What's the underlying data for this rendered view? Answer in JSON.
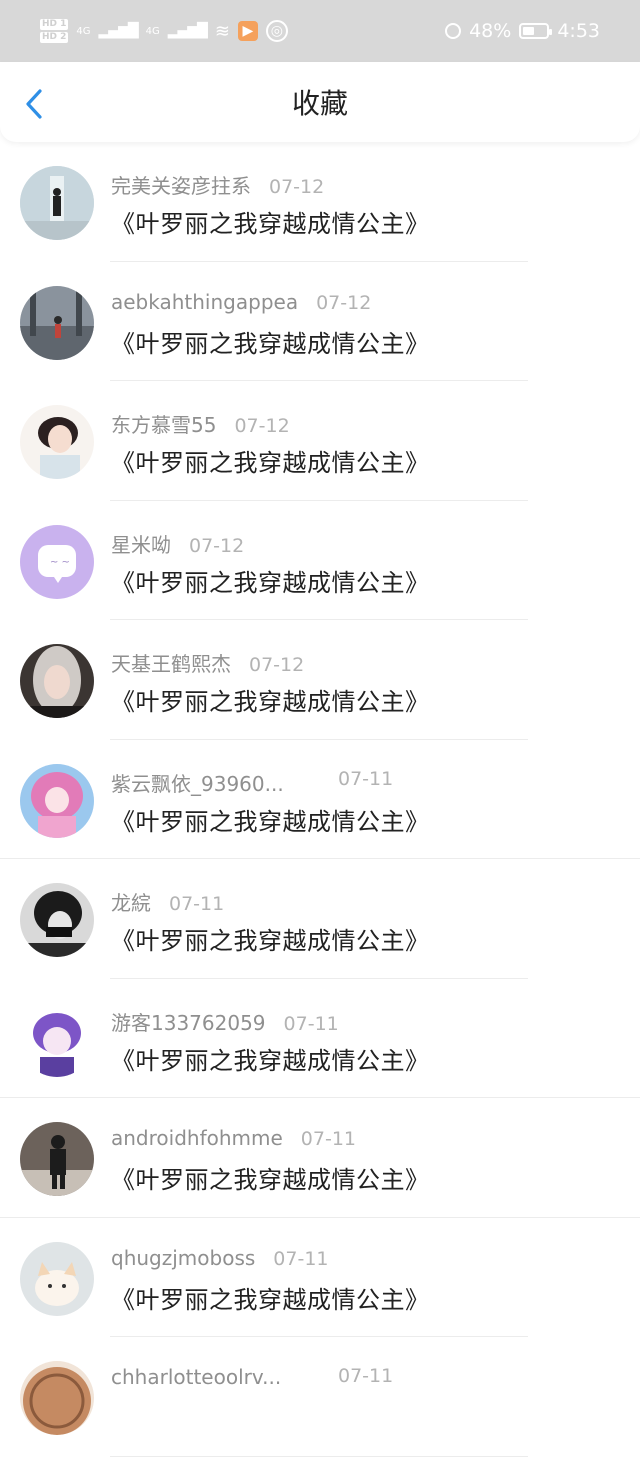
{
  "status_bar": {
    "hd1": "HD 1",
    "hd2": "HD 2",
    "net1": "4G",
    "net2": "4G",
    "battery": "48%",
    "time": "4:53",
    "battery_level": 0.48
  },
  "header": {
    "title": "收藏"
  },
  "items": [
    {
      "name": "完美关姿彦拄系",
      "date": "07-12",
      "book": "《叶罗丽之我穿越成情公主》"
    },
    {
      "name": "aebkahthingappea",
      "date": "07-12",
      "book": "《叶罗丽之我穿越成情公主》"
    },
    {
      "name": "东方慕雪55",
      "date": "07-12",
      "book": "《叶罗丽之我穿越成情公主》"
    },
    {
      "name": "星米呦",
      "date": "07-12",
      "book": "《叶罗丽之我穿越成情公主》"
    },
    {
      "name": "天基王鹤熙杰",
      "date": "07-12",
      "book": "《叶罗丽之我穿越成情公主》"
    },
    {
      "name": "紫云飘依_93960...",
      "date": "07-11",
      "book": "《叶罗丽之我穿越成情公主》"
    },
    {
      "name": "龙綄",
      "date": "07-11",
      "book": "《叶罗丽之我穿越成情公主》"
    },
    {
      "name": "游客133762059",
      "date": "07-11",
      "book": "《叶罗丽之我穿越成情公主》"
    },
    {
      "name": "androidhfohmme",
      "date": "07-11",
      "book": "《叶罗丽之我穿越成情公主》"
    },
    {
      "name": "qhugzjmoboss",
      "date": "07-11",
      "book": "《叶罗丽之我穿越成情公主》"
    },
    {
      "name": "chharlotteoolrv...",
      "date": "07-11",
      "book": ""
    }
  ],
  "colors": {
    "accent": "#2f8fe6",
    "status_bar_bg": "#d8d8d8",
    "name_text": "#8f8f8f",
    "date_text": "#b3b3b3",
    "title_text": "#222222"
  }
}
